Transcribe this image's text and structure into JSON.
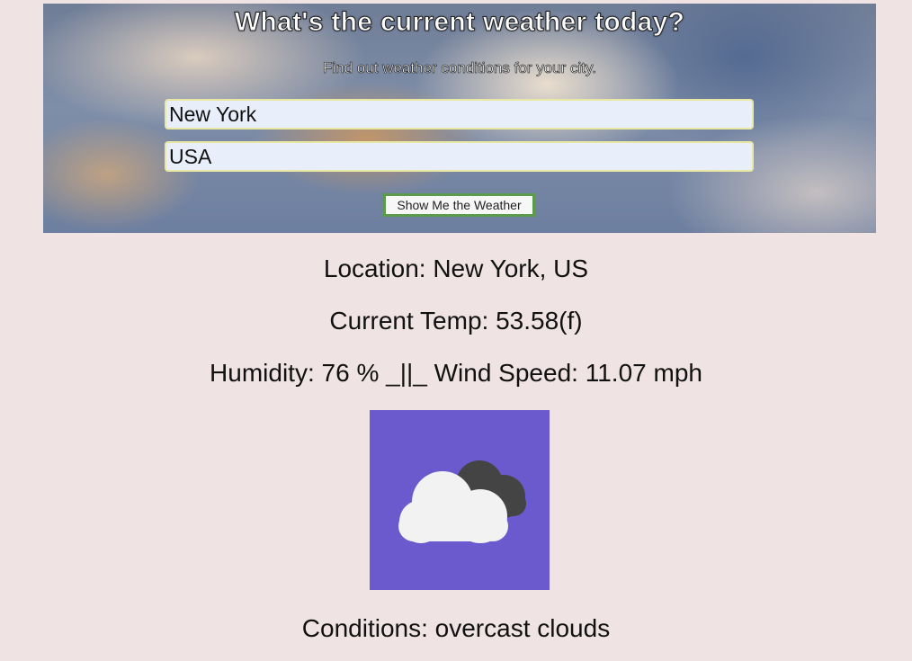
{
  "hero": {
    "title": "What's the current weather today?",
    "subtitle": "Find out weather conditions for your city."
  },
  "form": {
    "city_value": "New York",
    "country_value": "USA",
    "submit_label": "Show Me the Weather"
  },
  "results": {
    "location_label": "Location:",
    "location_value": "New York, US",
    "temp_label": "Current Temp:",
    "temp_value": "53.58(f)",
    "humidity_label": "Humidity:",
    "humidity_value": "76 %",
    "separator": "_||_",
    "wind_label": "Wind Speed:",
    "wind_value": "11.07 mph",
    "conditions_label": "Conditions:",
    "conditions_value": "overcast clouds"
  },
  "icon": {
    "name": "overcast-clouds-icon",
    "background": "#6a5acd",
    "cloud_front": "#f2f2f2",
    "cloud_back": "#444444"
  },
  "colors": {
    "page_background": "#efe3e3",
    "button_border": "#5c9a4c",
    "input_background": "#e8effa",
    "input_border": "#e9e8a3"
  }
}
